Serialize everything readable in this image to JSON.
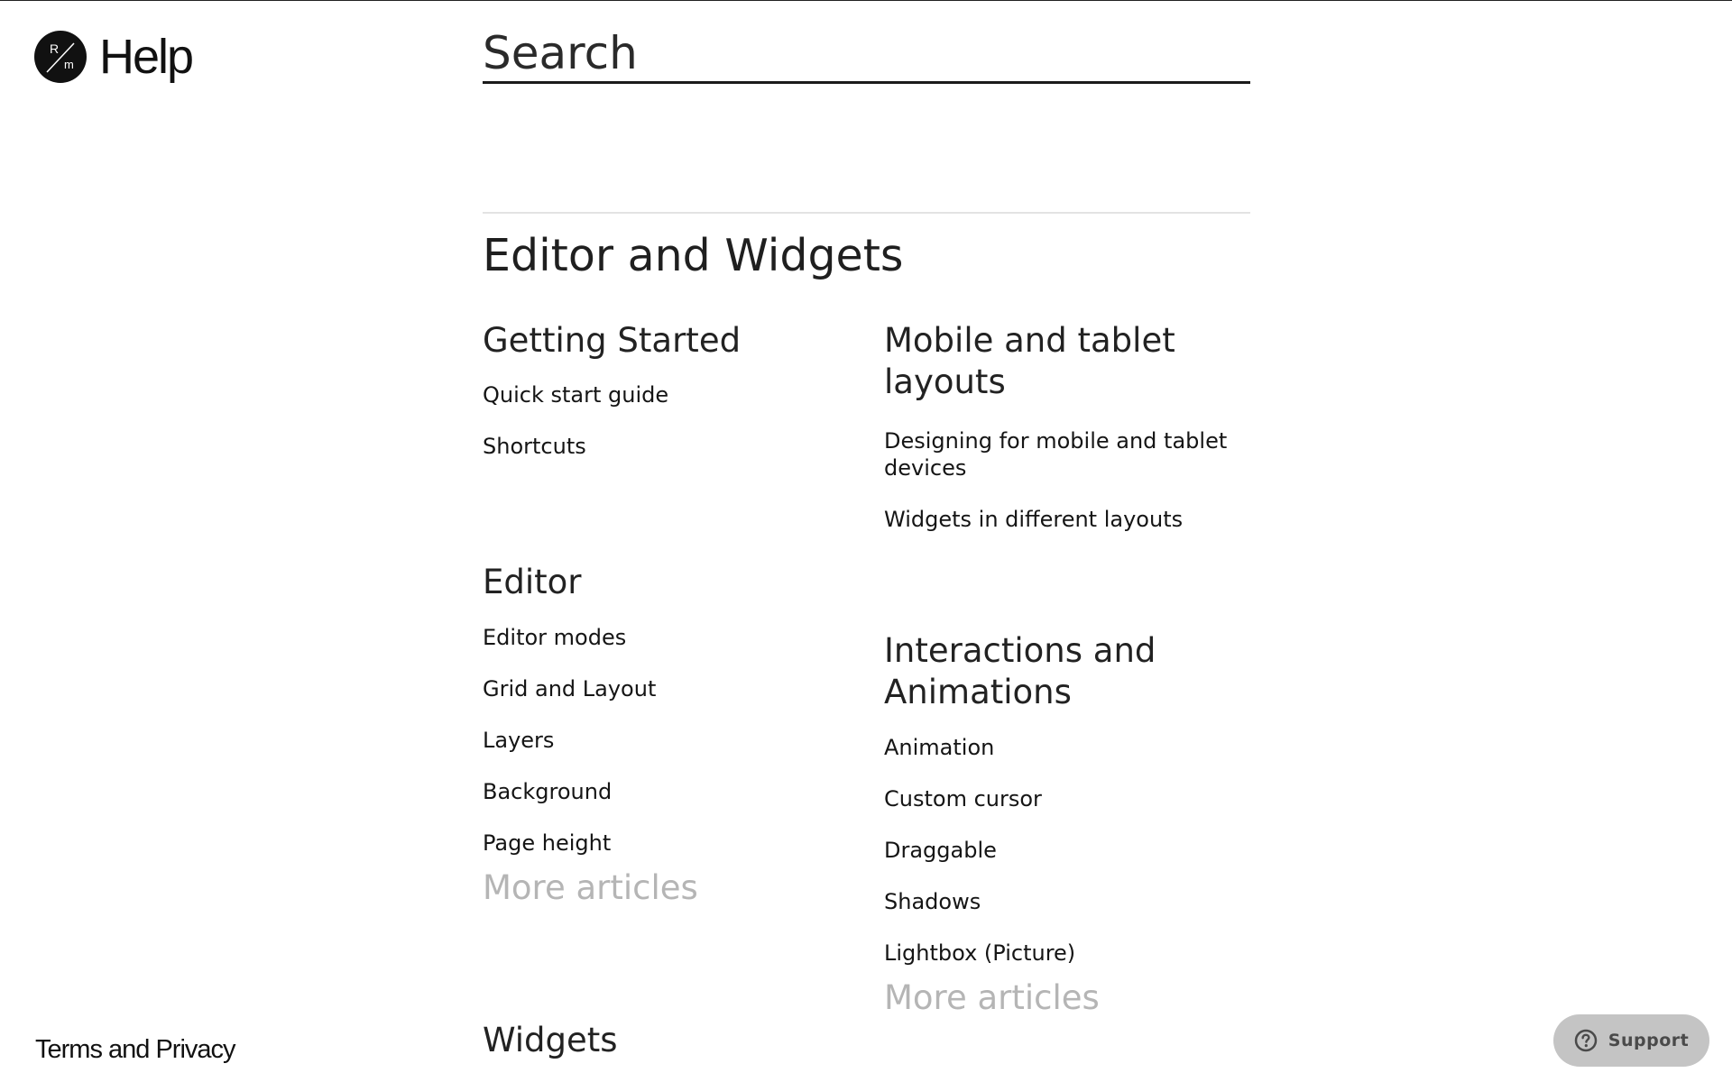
{
  "logo": {
    "badge_top": "R",
    "badge_bottom": "m",
    "text": "Help"
  },
  "search": {
    "placeholder": "Search",
    "value": ""
  },
  "main": {
    "title": "Editor and Widgets",
    "sections": [
      {
        "title": "Getting Started",
        "articles": [
          "Quick start guide",
          "Shortcuts"
        ]
      },
      {
        "title": "Mobile and tablet layouts",
        "articles": [
          "Designing for mobile and tablet devices",
          "Widgets in different layouts"
        ]
      },
      {
        "title": "Editor",
        "articles": [
          "Editor modes",
          "Grid and Layout",
          "Layers",
          "Background",
          "Page height"
        ],
        "more_label": "More articles"
      },
      {
        "title": "Interactions and Animations",
        "articles": [
          "Animation",
          "Custom cursor",
          "Draggable",
          "Shadows",
          "Lightbox (Picture)"
        ],
        "more_label": "More articles"
      },
      {
        "title": "Widgets",
        "articles": []
      }
    ]
  },
  "footer": {
    "terms_label": "Terms and Privacy"
  },
  "support": {
    "label": "Support"
  },
  "colors": {
    "text": "#1a1a1a",
    "muted_link": "#b5b5b5",
    "divider": "#e3e3e3",
    "support_bg": "#c4c4c4",
    "support_text": "#4a4a4a"
  },
  "icons": {
    "logo": "rm-logo-icon",
    "support": "question-circle-icon"
  }
}
